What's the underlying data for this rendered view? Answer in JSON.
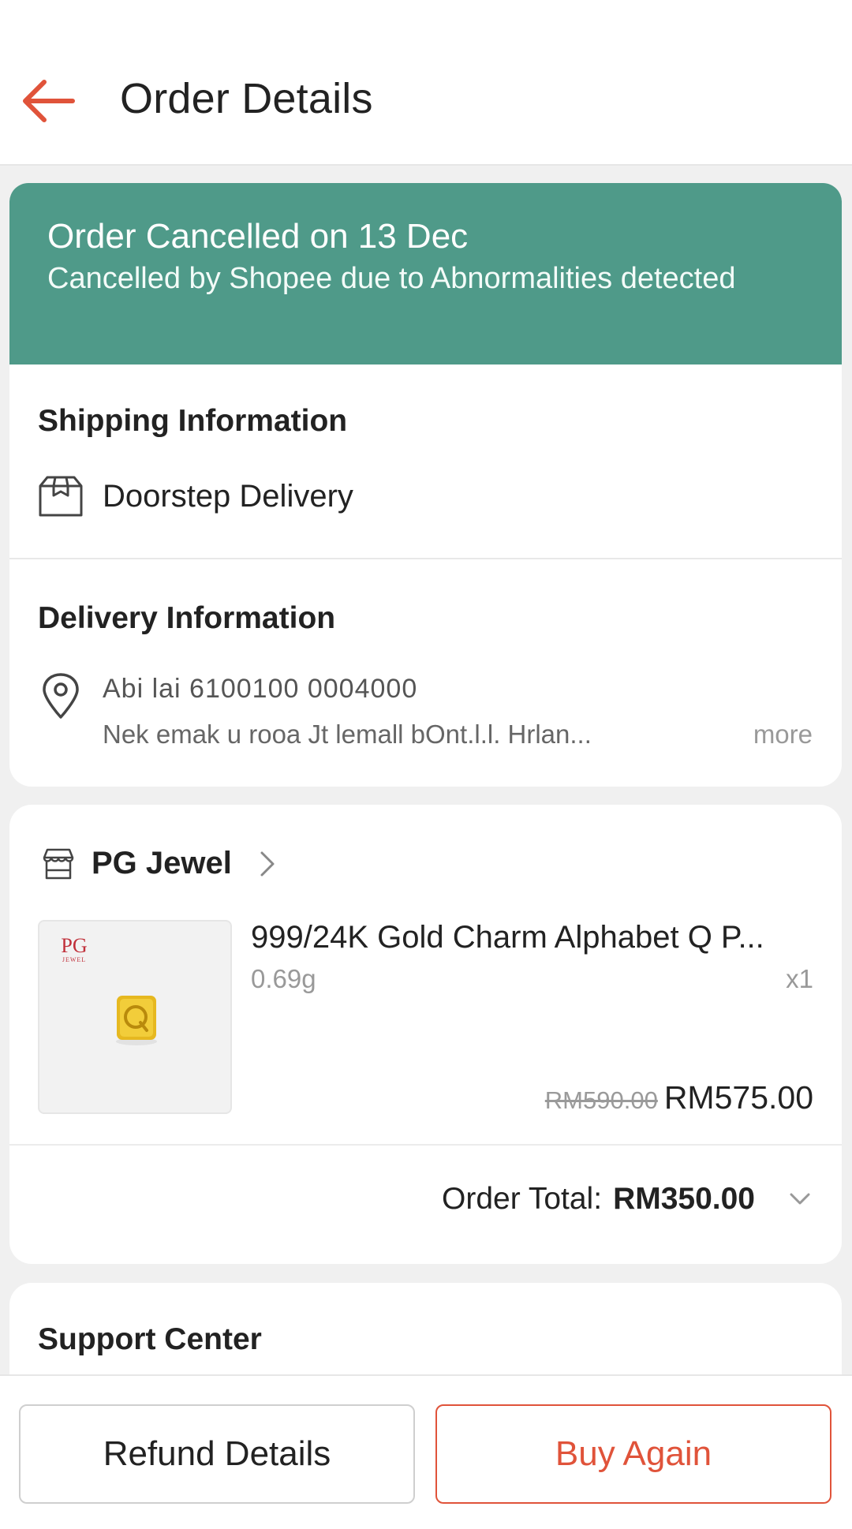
{
  "header": {
    "title": "Order Details",
    "back_icon": "arrow-left-icon",
    "accent_color": "#e0533a"
  },
  "status_banner": {
    "title": "Order Cancelled on 13 Dec",
    "subtitle": "Cancelled by Shopee due to Abnormalities detected",
    "background_color": "#4f9a89"
  },
  "shipping": {
    "title": "Shipping Information",
    "method": "Doorstep Delivery",
    "icon": "package-icon"
  },
  "delivery": {
    "title": "Delivery Information",
    "icon": "location-pin-icon",
    "recipient_line": "Abi lai 6100100 0004000",
    "address_line": "Nek emak u rooa Jt lemall bOnt.l.l. Hrlan...",
    "more_label": "more"
  },
  "shop": {
    "name": "PG Jewel",
    "icon": "store-icon",
    "product": {
      "name": "999/24K Gold Charm Alphabet Q P...",
      "variant": "0.69g",
      "quantity": "x1",
      "original_price": "RM590.00",
      "price": "RM575.00",
      "thumb_brand": "PG",
      "thumb_brand_sub": "JEWEL"
    },
    "order_total_label": "Order Total:",
    "order_total_value": "RM350.00"
  },
  "support": {
    "title": "Support Center"
  },
  "actions": {
    "refund_label": "Refund Details",
    "buy_again_label": "Buy Again"
  }
}
